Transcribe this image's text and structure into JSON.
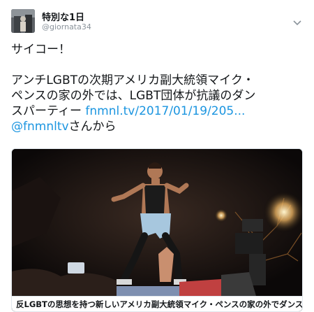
{
  "user": {
    "display_name": "特別な1日",
    "handle": "@giornata34"
  },
  "tweet": {
    "line1": "サイコー！",
    "line2a": "アンチLGBTの次期アメリカ副大統領マイク・",
    "line2b": "ペンスの家の外では、LGBT団体が抗議のダン",
    "line2c_text": "スパーティー ",
    "link_url": "fnmnl.tv/2017/01/19/205...",
    "mention": "@fnmnltv",
    "mention_suffix": "さんから"
  },
  "card": {
    "title": "反LGBTの思想を持つ新しいアメリカ副大統領マイク・ペンスの家の外でダンスパ..."
  },
  "icons": {
    "menu": "chevron-down-icon"
  },
  "colors": {
    "link": "#1b95e0",
    "text": "#14171a",
    "muted": "#8a939b"
  }
}
